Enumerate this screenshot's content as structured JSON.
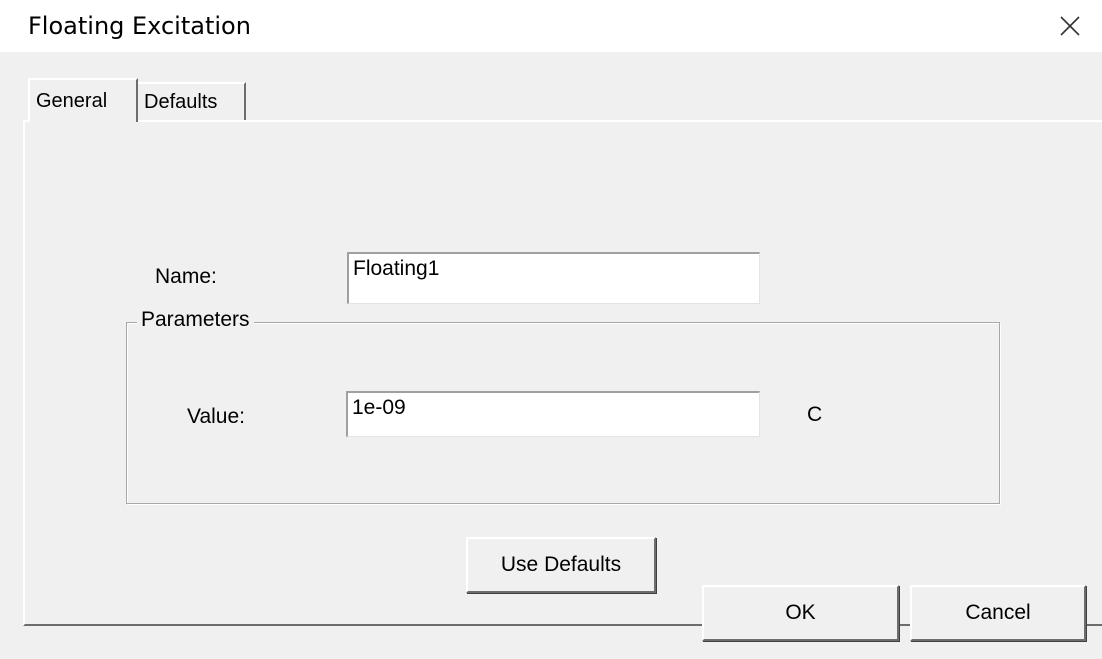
{
  "window": {
    "title": "Floating Excitation",
    "close_icon": "close-icon"
  },
  "tabs": [
    {
      "label": "General",
      "selected": true
    },
    {
      "label": "Defaults",
      "selected": false
    }
  ],
  "general": {
    "name_label": "Name:",
    "name_value": "Floating1",
    "parameters": {
      "legend": "Parameters",
      "value_label": "Value:",
      "value": "1e-09",
      "unit": "C"
    },
    "use_defaults_label": "Use Defaults"
  },
  "footer": {
    "ok_label": "OK",
    "cancel_label": "Cancel"
  }
}
